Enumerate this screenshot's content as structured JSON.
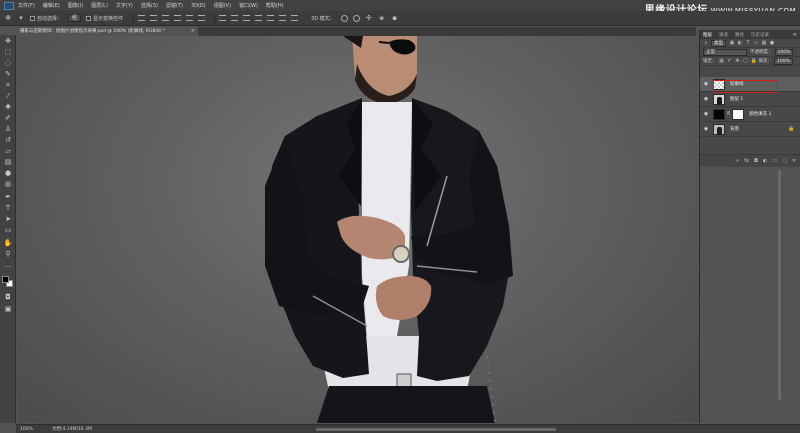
{
  "menu": {
    "items": [
      "文件(F)",
      "编辑(E)",
      "图像(I)",
      "图层(L)",
      "文字(Y)",
      "选择(S)",
      "滤镜(T)",
      "3D(D)",
      "视图(V)",
      "窗口(W)",
      "帮助(H)"
    ]
  },
  "watermark": {
    "main": "思缘设计论坛",
    "sub": "WWW.MISSYUAN.COM"
  },
  "options": {
    "auto_select_label": "自动选择：",
    "auto_select_value": "组",
    "show_transform_label": "显示变换控件",
    "mode_3d": "3D 模式："
  },
  "document": {
    "tab_title": "摄影与后期修饰：绘图片创建指示效果.psd @ 100% (轮廓线, RGB/8) *",
    "close_icon": "×"
  },
  "status": {
    "zoom": "100%",
    "doc_info": "文档:4.14M/16.3M"
  },
  "layers_panel": {
    "tabs": [
      "图层",
      "通道",
      "路径",
      "历史记录"
    ],
    "kind_select": "类型",
    "blend_mode": "正常",
    "opacity_label": "不透明度：",
    "opacity_value": "100%",
    "lock_label": "锁定：",
    "fill_label": "填充：",
    "fill_value": "100%",
    "layers": [
      {
        "name": "轮廓线",
        "thumb": "checker",
        "selected": true
      },
      {
        "name": "图层 1",
        "thumb": "person",
        "selected": false
      },
      {
        "name": "颜色填充 1",
        "thumb": "black",
        "mask": "white",
        "selected": false
      },
      {
        "name": "背景",
        "thumb": "bgphoto",
        "selected": false
      }
    ]
  },
  "colors": {
    "selection_outline": "#d11e1e",
    "foreground_swatch": "#000000",
    "background_swatch": "#ffffff"
  }
}
